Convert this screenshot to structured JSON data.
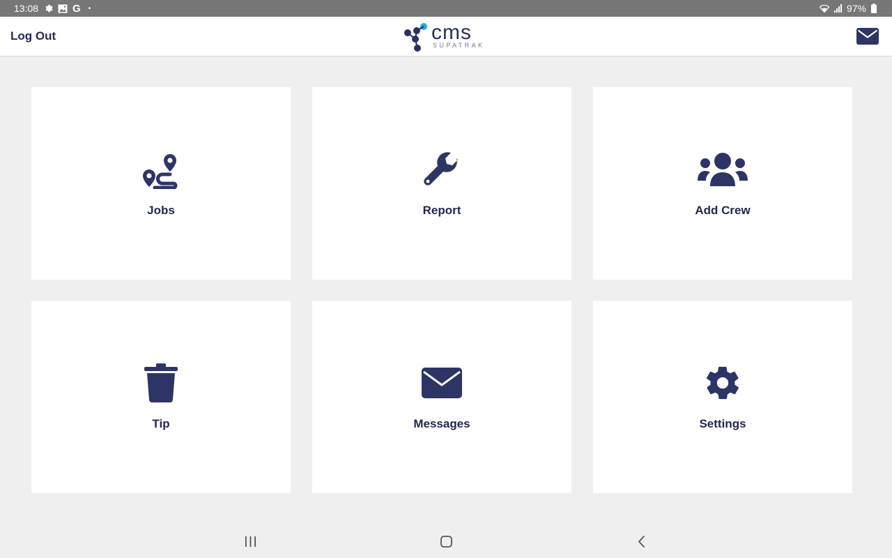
{
  "status_bar": {
    "time": "13:08",
    "left_icons": [
      "settings-icon",
      "image-icon",
      "google-icon"
    ],
    "google_glyph": "G",
    "notification_dot": "•",
    "battery_percent": "97%",
    "right_icons": [
      "wifi-icon",
      "signal-icon",
      "battery-icon"
    ]
  },
  "app_bar": {
    "logout_label": "Log Out",
    "logo_text": "cms",
    "logo_subtext": "SUPATRAK",
    "right_icon": "mail-icon"
  },
  "tiles": [
    {
      "label": "Jobs",
      "icon": "route-icon"
    },
    {
      "label": "Report",
      "icon": "wrench-icon"
    },
    {
      "label": "Add Crew",
      "icon": "users-icon"
    },
    {
      "label": "Tip",
      "icon": "trash-icon"
    },
    {
      "label": "Messages",
      "icon": "envelope-icon"
    },
    {
      "label": "Settings",
      "icon": "gear-icon"
    }
  ],
  "nav_bar": {
    "buttons": [
      "recent-apps-icon",
      "home-icon",
      "back-icon"
    ]
  },
  "colors": {
    "primary": "#2d3466",
    "label": "#232850",
    "logo_accent": "#29a8df",
    "background": "#efefef",
    "status_bar": "#777777"
  }
}
